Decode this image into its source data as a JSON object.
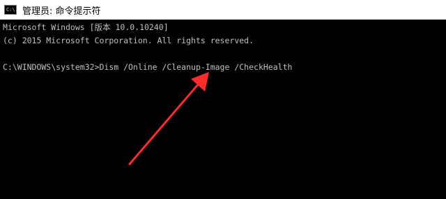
{
  "window": {
    "title": "管理员: 命令提示符",
    "icon": "cmd-icon",
    "icon_text": "C:\\."
  },
  "console": {
    "lines": [
      "Microsoft Windows [版本 10.0.10240]",
      "(c) 2015 Microsoft Corporation. All rights reserved.",
      "",
      "C:\\WINDOWS\\system32>Dism /Online /Cleanup-Image /CheckHealth"
    ],
    "text_color": "#c0c0c0",
    "background_color": "#000000"
  },
  "annotation": {
    "type": "arrow",
    "color": "#ff2a2a",
    "icon": "red-arrow-icon"
  }
}
